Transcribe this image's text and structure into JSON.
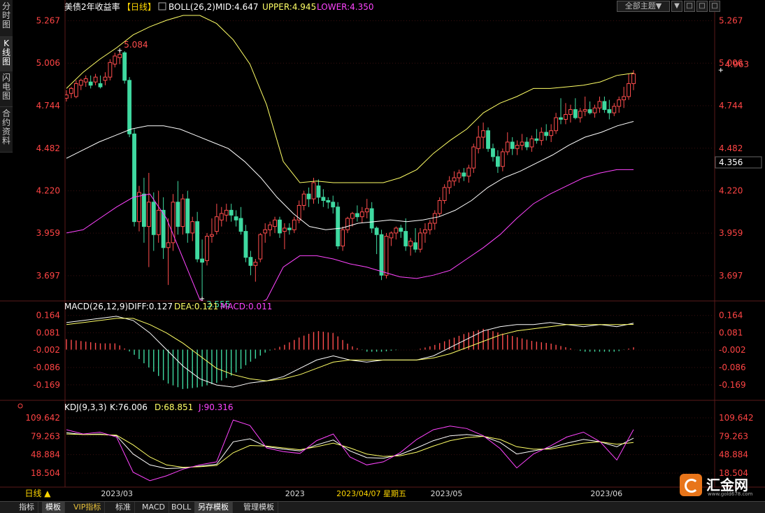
{
  "sidebar": {
    "tabs": [
      {
        "label": "分时图"
      },
      {
        "label": "K线图"
      },
      {
        "label": "闪电图"
      },
      {
        "label": "合约资料"
      }
    ]
  },
  "toolbar": {
    "theme_label": "全部主题▼",
    "btn1": "▼",
    "btn2": "□",
    "btn3": "□",
    "btn4": "□"
  },
  "main_header": {
    "title": "美债2年收益率",
    "period": "【日线】",
    "indicator": "BOLL(26,2)",
    "mid": "MID:4.647",
    "upper": "UPPER:4.945",
    "lower": "LOWER:4.350"
  },
  "macd_header": {
    "name": "MACD(26,12,9)",
    "diff": "DIFF:0.127",
    "dea": "DEA:0.121",
    "macd": "MACD:0.011"
  },
  "kdj_header": {
    "name": "KDJ(9,3,3)",
    "k": "K:76.006",
    "d": "D:68.851",
    "j": "J:90.316"
  },
  "current_price": "4.356",
  "bottom_bar": {
    "period_button": "日线 ▲",
    "tabs": [
      {
        "label": "指标"
      },
      {
        "label": "模板"
      },
      {
        "label": "VIP指标"
      },
      {
        "label": "标准"
      },
      {
        "label": "MACD"
      },
      {
        "label": "BOLL"
      },
      {
        "label": "另存模板"
      },
      {
        "label": "管理模板"
      }
    ]
  },
  "logo": {
    "text": "汇金网",
    "url": "www.gold678.com"
  },
  "colors": {
    "up": "#ff4d4d",
    "down": "#3fd9a0",
    "mid": "#ffffff",
    "upper": "#ffff66",
    "lower": "#ff44ff",
    "axis_red": "#ff4444",
    "grid": "#552222"
  },
  "chart_data": [
    {
      "type": "candlestick",
      "name": "美债2年收益率 日线 BOLL(26,2)",
      "y_ticks": [
        5.267,
        5.006,
        4.744,
        4.482,
        4.22,
        3.959,
        3.697
      ],
      "ylim": [
        3.52,
        5.3
      ],
      "x_tick_labels": [
        {
          "index": 10,
          "label": "2023/03"
        },
        {
          "index": 48,
          "label": "2023"
        },
        {
          "index": 56,
          "label": "2023/04/07 星期五"
        },
        {
          "index": 78,
          "label": "2023/05"
        },
        {
          "index": 111,
          "label": "2023/06"
        }
      ],
      "annotations": [
        {
          "index": 11,
          "value": 5.084,
          "label": "5.084"
        },
        {
          "index": 28,
          "value": 3.555,
          "label": "3.555"
        },
        {
          "index": 135,
          "value": 4.963,
          "label": "4.963"
        }
      ],
      "candles": [
        {
          "o": 4.79,
          "h": 4.84,
          "l": 4.77,
          "c": 4.81
        },
        {
          "o": 4.82,
          "h": 4.86,
          "l": 4.79,
          "c": 4.85
        },
        {
          "o": 4.8,
          "h": 4.9,
          "l": 4.79,
          "c": 4.88
        },
        {
          "o": 4.87,
          "h": 4.91,
          "l": 4.84,
          "c": 4.9
        },
        {
          "o": 4.89,
          "h": 4.93,
          "l": 4.86,
          "c": 4.91
        },
        {
          "o": 4.89,
          "h": 4.93,
          "l": 4.85,
          "c": 4.87
        },
        {
          "o": 4.89,
          "h": 4.94,
          "l": 4.87,
          "c": 4.92
        },
        {
          "o": 4.88,
          "h": 4.93,
          "l": 4.85,
          "c": 4.86
        },
        {
          "o": 4.9,
          "h": 4.95,
          "l": 4.87,
          "c": 4.92
        },
        {
          "o": 4.92,
          "h": 5.03,
          "l": 4.9,
          "c": 5.01
        },
        {
          "o": 5.0,
          "h": 5.07,
          "l": 4.98,
          "c": 5.05
        },
        {
          "o": 5.04,
          "h": 5.084,
          "l": 5.0,
          "c": 5.06
        },
        {
          "o": 5.07,
          "h": 5.08,
          "l": 4.88,
          "c": 4.9
        },
        {
          "o": 4.9,
          "h": 4.92,
          "l": 4.55,
          "c": 4.57
        },
        {
          "o": 4.57,
          "h": 4.6,
          "l": 4.0,
          "c": 4.03
        },
        {
          "o": 4.03,
          "h": 4.25,
          "l": 3.97,
          "c": 4.21
        },
        {
          "o": 4.2,
          "h": 4.3,
          "l": 3.9,
          "c": 4.0
        },
        {
          "o": 4.0,
          "h": 4.33,
          "l": 3.75,
          "c": 4.15
        },
        {
          "o": 4.15,
          "h": 4.21,
          "l": 3.85,
          "c": 3.95
        },
        {
          "o": 3.95,
          "h": 4.22,
          "l": 3.9,
          "c": 4.1
        },
        {
          "o": 4.1,
          "h": 4.18,
          "l": 3.8,
          "c": 3.87
        },
        {
          "o": 3.87,
          "h": 4.05,
          "l": 3.64,
          "c": 3.9
        },
        {
          "o": 3.9,
          "h": 4.2,
          "l": 3.85,
          "c": 4.15
        },
        {
          "o": 4.15,
          "h": 4.28,
          "l": 3.95,
          "c": 4.0
        },
        {
          "o": 4.0,
          "h": 4.2,
          "l": 3.95,
          "c": 4.17
        },
        {
          "o": 4.17,
          "h": 4.22,
          "l": 3.9,
          "c": 3.96
        },
        {
          "o": 3.96,
          "h": 4.06,
          "l": 3.91,
          "c": 4.03
        },
        {
          "o": 4.03,
          "h": 4.09,
          "l": 3.78,
          "c": 3.8
        },
        {
          "o": 3.8,
          "h": 3.92,
          "l": 3.555,
          "c": 3.78
        },
        {
          "o": 3.79,
          "h": 3.96,
          "l": 3.76,
          "c": 3.94
        },
        {
          "o": 3.94,
          "h": 4.05,
          "l": 3.9,
          "c": 3.95
        },
        {
          "o": 3.97,
          "h": 4.14,
          "l": 3.95,
          "c": 4.06
        },
        {
          "o": 4.04,
          "h": 4.12,
          "l": 4.0,
          "c": 4.08
        },
        {
          "o": 4.07,
          "h": 4.14,
          "l": 4.03,
          "c": 4.1
        },
        {
          "o": 4.1,
          "h": 4.14,
          "l": 4.03,
          "c": 4.07
        },
        {
          "o": 4.06,
          "h": 4.1,
          "l": 4.0,
          "c": 4.04
        },
        {
          "o": 4.05,
          "h": 4.12,
          "l": 3.95,
          "c": 3.97
        },
        {
          "o": 3.97,
          "h": 4.01,
          "l": 3.78,
          "c": 3.81
        },
        {
          "o": 3.81,
          "h": 3.85,
          "l": 3.7,
          "c": 3.76
        },
        {
          "o": 3.76,
          "h": 3.8,
          "l": 3.66,
          "c": 3.78
        },
        {
          "o": 3.8,
          "h": 3.96,
          "l": 3.78,
          "c": 3.95
        },
        {
          "o": 3.96,
          "h": 4.02,
          "l": 3.9,
          "c": 3.98
        },
        {
          "o": 3.98,
          "h": 4.03,
          "l": 3.94,
          "c": 4.01
        },
        {
          "o": 4.0,
          "h": 4.06,
          "l": 3.96,
          "c": 4.04
        },
        {
          "o": 4.04,
          "h": 4.06,
          "l": 3.93,
          "c": 3.96
        },
        {
          "o": 3.97,
          "h": 4.02,
          "l": 3.86,
          "c": 3.99
        },
        {
          "o": 3.99,
          "h": 4.02,
          "l": 3.95,
          "c": 3.98
        },
        {
          "o": 3.98,
          "h": 4.06,
          "l": 3.96,
          "c": 4.04
        },
        {
          "o": 4.04,
          "h": 4.16,
          "l": 4.02,
          "c": 4.13
        },
        {
          "o": 4.13,
          "h": 4.22,
          "l": 4.1,
          "c": 4.2
        },
        {
          "o": 4.2,
          "h": 4.24,
          "l": 4.12,
          "c": 4.17
        },
        {
          "o": 4.17,
          "h": 4.3,
          "l": 4.14,
          "c": 4.27
        },
        {
          "o": 4.25,
          "h": 4.29,
          "l": 4.14,
          "c": 4.18
        },
        {
          "o": 4.18,
          "h": 4.23,
          "l": 4.12,
          "c": 4.16
        },
        {
          "o": 4.16,
          "h": 4.18,
          "l": 4.11,
          "c": 4.15
        },
        {
          "o": 4.15,
          "h": 4.19,
          "l": 4.08,
          "c": 4.12
        },
        {
          "o": 4.12,
          "h": 4.15,
          "l": 3.86,
          "c": 3.88
        },
        {
          "o": 3.88,
          "h": 4.0,
          "l": 3.85,
          "c": 3.98
        },
        {
          "o": 3.98,
          "h": 4.06,
          "l": 3.96,
          "c": 4.05
        },
        {
          "o": 4.05,
          "h": 4.09,
          "l": 4.0,
          "c": 4.08
        },
        {
          "o": 4.08,
          "h": 4.13,
          "l": 4.03,
          "c": 4.06
        },
        {
          "o": 4.06,
          "h": 4.12,
          "l": 4.02,
          "c": 4.09
        },
        {
          "o": 4.09,
          "h": 4.17,
          "l": 4.05,
          "c": 4.11
        },
        {
          "o": 4.11,
          "h": 4.15,
          "l": 3.96,
          "c": 3.99
        },
        {
          "o": 3.99,
          "h": 4.0,
          "l": 3.83,
          "c": 3.95
        },
        {
          "o": 3.95,
          "h": 3.98,
          "l": 3.67,
          "c": 3.7
        },
        {
          "o": 3.7,
          "h": 3.96,
          "l": 3.68,
          "c": 3.94
        },
        {
          "o": 3.93,
          "h": 3.97,
          "l": 3.88,
          "c": 3.96
        },
        {
          "o": 3.96,
          "h": 4.0,
          "l": 3.92,
          "c": 3.99
        },
        {
          "o": 3.99,
          "h": 4.01,
          "l": 3.93,
          "c": 3.97
        },
        {
          "o": 3.97,
          "h": 4.05,
          "l": 3.85,
          "c": 3.88
        },
        {
          "o": 3.88,
          "h": 3.93,
          "l": 3.82,
          "c": 3.91
        },
        {
          "o": 3.9,
          "h": 3.99,
          "l": 3.84,
          "c": 3.86
        },
        {
          "o": 3.86,
          "h": 3.99,
          "l": 3.84,
          "c": 3.96
        },
        {
          "o": 3.96,
          "h": 4.02,
          "l": 3.9,
          "c": 3.98
        },
        {
          "o": 3.98,
          "h": 4.04,
          "l": 3.95,
          "c": 4.02
        },
        {
          "o": 4.02,
          "h": 4.1,
          "l": 3.98,
          "c": 4.08
        },
        {
          "o": 4.08,
          "h": 4.18,
          "l": 4.06,
          "c": 4.16
        },
        {
          "o": 4.16,
          "h": 4.26,
          "l": 4.14,
          "c": 4.24
        },
        {
          "o": 4.24,
          "h": 4.31,
          "l": 4.2,
          "c": 4.28
        },
        {
          "o": 4.28,
          "h": 4.34,
          "l": 4.25,
          "c": 4.3
        },
        {
          "o": 4.3,
          "h": 4.35,
          "l": 4.27,
          "c": 4.33
        },
        {
          "o": 4.33,
          "h": 4.36,
          "l": 4.28,
          "c": 4.31
        },
        {
          "o": 4.31,
          "h": 4.38,
          "l": 4.27,
          "c": 4.36
        },
        {
          "o": 4.36,
          "h": 4.51,
          "l": 4.33,
          "c": 4.49
        },
        {
          "o": 4.48,
          "h": 4.62,
          "l": 4.45,
          "c": 4.55
        },
        {
          "o": 4.55,
          "h": 4.64,
          "l": 4.48,
          "c": 4.59
        },
        {
          "o": 4.59,
          "h": 4.61,
          "l": 4.46,
          "c": 4.48
        },
        {
          "o": 4.48,
          "h": 4.51,
          "l": 4.4,
          "c": 4.43
        },
        {
          "o": 4.43,
          "h": 4.47,
          "l": 4.33,
          "c": 4.37
        },
        {
          "o": 4.37,
          "h": 4.48,
          "l": 4.34,
          "c": 4.46
        },
        {
          "o": 4.46,
          "h": 4.58,
          "l": 4.44,
          "c": 4.52
        },
        {
          "o": 4.52,
          "h": 4.55,
          "l": 4.44,
          "c": 4.48
        },
        {
          "o": 4.48,
          "h": 4.53,
          "l": 4.44,
          "c": 4.5
        },
        {
          "o": 4.5,
          "h": 4.57,
          "l": 4.47,
          "c": 4.52
        },
        {
          "o": 4.52,
          "h": 4.55,
          "l": 4.47,
          "c": 4.49
        },
        {
          "o": 4.49,
          "h": 4.56,
          "l": 4.46,
          "c": 4.54
        },
        {
          "o": 4.54,
          "h": 4.6,
          "l": 4.51,
          "c": 4.53
        },
        {
          "o": 4.53,
          "h": 4.61,
          "l": 4.5,
          "c": 4.58
        },
        {
          "o": 4.58,
          "h": 4.63,
          "l": 4.53,
          "c": 4.56
        },
        {
          "o": 4.56,
          "h": 4.63,
          "l": 4.52,
          "c": 4.59
        },
        {
          "o": 4.59,
          "h": 4.7,
          "l": 4.57,
          "c": 4.67
        },
        {
          "o": 4.67,
          "h": 4.79,
          "l": 4.63,
          "c": 4.66
        },
        {
          "o": 4.66,
          "h": 4.76,
          "l": 4.63,
          "c": 4.69
        },
        {
          "o": 4.69,
          "h": 4.75,
          "l": 4.64,
          "c": 4.72
        },
        {
          "o": 4.72,
          "h": 4.79,
          "l": 4.66,
          "c": 4.67
        },
        {
          "o": 4.67,
          "h": 4.73,
          "l": 4.64,
          "c": 4.71
        },
        {
          "o": 4.71,
          "h": 4.8,
          "l": 4.68,
          "c": 4.72
        },
        {
          "o": 4.72,
          "h": 4.77,
          "l": 4.69,
          "c": 4.7
        },
        {
          "o": 4.7,
          "h": 4.75,
          "l": 4.67,
          "c": 4.73
        },
        {
          "o": 4.73,
          "h": 4.8,
          "l": 4.7,
          "c": 4.77
        },
        {
          "o": 4.77,
          "h": 4.8,
          "l": 4.7,
          "c": 4.72
        },
        {
          "o": 4.72,
          "h": 4.78,
          "l": 4.66,
          "c": 4.7
        },
        {
          "o": 4.7,
          "h": 4.76,
          "l": 4.68,
          "c": 4.74
        },
        {
          "o": 4.74,
          "h": 4.8,
          "l": 4.7,
          "c": 4.78
        },
        {
          "o": 4.78,
          "h": 4.86,
          "l": 4.73,
          "c": 4.8
        },
        {
          "o": 4.8,
          "h": 4.94,
          "l": 4.78,
          "c": 4.88
        },
        {
          "o": 4.88,
          "h": 4.963,
          "l": 4.84,
          "c": 4.94
        }
      ],
      "boll": {
        "mid": [
          4.42,
          4.47,
          4.52,
          4.56,
          4.6,
          4.62,
          4.62,
          4.6,
          4.56,
          4.52,
          4.48,
          4.4,
          4.3,
          4.18,
          4.08,
          4.0,
          3.98,
          3.99,
          4.02,
          4.03,
          4.04,
          4.03,
          4.04,
          4.06,
          4.1,
          4.16,
          4.24,
          4.3,
          4.34,
          4.39,
          4.44,
          4.5,
          4.55,
          4.58,
          4.62,
          4.647
        ],
        "upper": [
          4.85,
          4.95,
          5.03,
          5.1,
          5.18,
          5.23,
          5.27,
          5.3,
          5.3,
          5.25,
          5.15,
          5.0,
          4.75,
          4.4,
          4.27,
          4.28,
          4.27,
          4.27,
          4.27,
          4.27,
          4.3,
          4.35,
          4.45,
          4.53,
          4.6,
          4.7,
          4.76,
          4.8,
          4.85,
          4.85,
          4.86,
          4.87,
          4.89,
          4.93,
          4.945
        ],
        "lower": [
          3.96,
          3.98,
          4.05,
          4.12,
          4.18,
          4.2,
          4.05,
          3.8,
          3.55,
          3.5,
          3.49,
          3.5,
          3.55,
          3.75,
          3.82,
          3.82,
          3.8,
          3.77,
          3.75,
          3.72,
          3.69,
          3.68,
          3.7,
          3.73,
          3.8,
          3.87,
          3.95,
          4.05,
          4.14,
          4.2,
          4.25,
          4.3,
          4.33,
          4.35,
          4.35
        ]
      }
    },
    {
      "type": "macd",
      "name": "MACD(26,12,9)",
      "y_ticks": [
        0.164,
        0.081,
        -0.002,
        -0.086,
        -0.169
      ],
      "ylim": [
        -0.23,
        0.19
      ],
      "diff": [
        0.13,
        0.14,
        0.15,
        0.16,
        0.14,
        0.08,
        0.0,
        -0.08,
        -0.14,
        -0.17,
        -0.18,
        -0.16,
        -0.15,
        -0.13,
        -0.09,
        -0.05,
        -0.03,
        -0.05,
        -0.06,
        -0.05,
        -0.05,
        -0.05,
        -0.03,
        0.01,
        0.05,
        0.09,
        0.11,
        0.12,
        0.12,
        0.13,
        0.12,
        0.11,
        0.12,
        0.11,
        0.127
      ],
      "dea": [
        0.12,
        0.13,
        0.14,
        0.15,
        0.15,
        0.12,
        0.08,
        0.03,
        -0.03,
        -0.09,
        -0.12,
        -0.14,
        -0.15,
        -0.14,
        -0.12,
        -0.09,
        -0.06,
        -0.05,
        -0.05,
        -0.05,
        -0.05,
        -0.05,
        -0.04,
        -0.02,
        0.01,
        0.04,
        0.07,
        0.09,
        0.1,
        0.11,
        0.12,
        0.12,
        0.12,
        0.12,
        0.121
      ],
      "histogram": [
        0.05,
        0.04,
        0.03,
        0.03,
        -0.02,
        -0.09,
        -0.16,
        -0.19,
        -0.18,
        -0.16,
        -0.12,
        -0.06,
        -0.01,
        0.02,
        0.06,
        0.09,
        0.08,
        0.02,
        -0.01,
        -0.01,
        0.0,
        0.0,
        0.02,
        0.05,
        0.08,
        0.1,
        0.08,
        0.06,
        0.04,
        0.03,
        0.01,
        -0.01,
        -0.01,
        -0.01,
        0.011
      ]
    },
    {
      "type": "kdj",
      "name": "KDJ(9,3,3)",
      "y_ticks": [
        109.642,
        79.263,
        48.884,
        18.504
      ],
      "ylim": [
        0,
        120
      ],
      "k": [
        85,
        82,
        83,
        80,
        50,
        32,
        26,
        27,
        30,
        33,
        70,
        75,
        62,
        58,
        55,
        65,
        73,
        55,
        44,
        43,
        49,
        60,
        72,
        80,
        82,
        79,
        69,
        50,
        55,
        60,
        68,
        74,
        70,
        62,
        76.006
      ],
      "d": [
        83,
        82,
        82,
        81,
        65,
        45,
        32,
        28,
        29,
        31,
        52,
        64,
        63,
        60,
        57,
        62,
        68,
        60,
        50,
        46,
        47,
        53,
        63,
        72,
        77,
        79,
        74,
        62,
        58,
        58,
        63,
        68,
        70,
        66,
        68.851
      ],
      "j": [
        90,
        83,
        86,
        78,
        20,
        6,
        14,
        25,
        32,
        37,
        106,
        97,
        60,
        54,
        51,
        72,
        83,
        45,
        32,
        37,
        52,
        74,
        90,
        96,
        92,
        80,
        59,
        27,
        50,
        63,
        78,
        86,
        70,
        40,
        90.316
      ]
    }
  ]
}
